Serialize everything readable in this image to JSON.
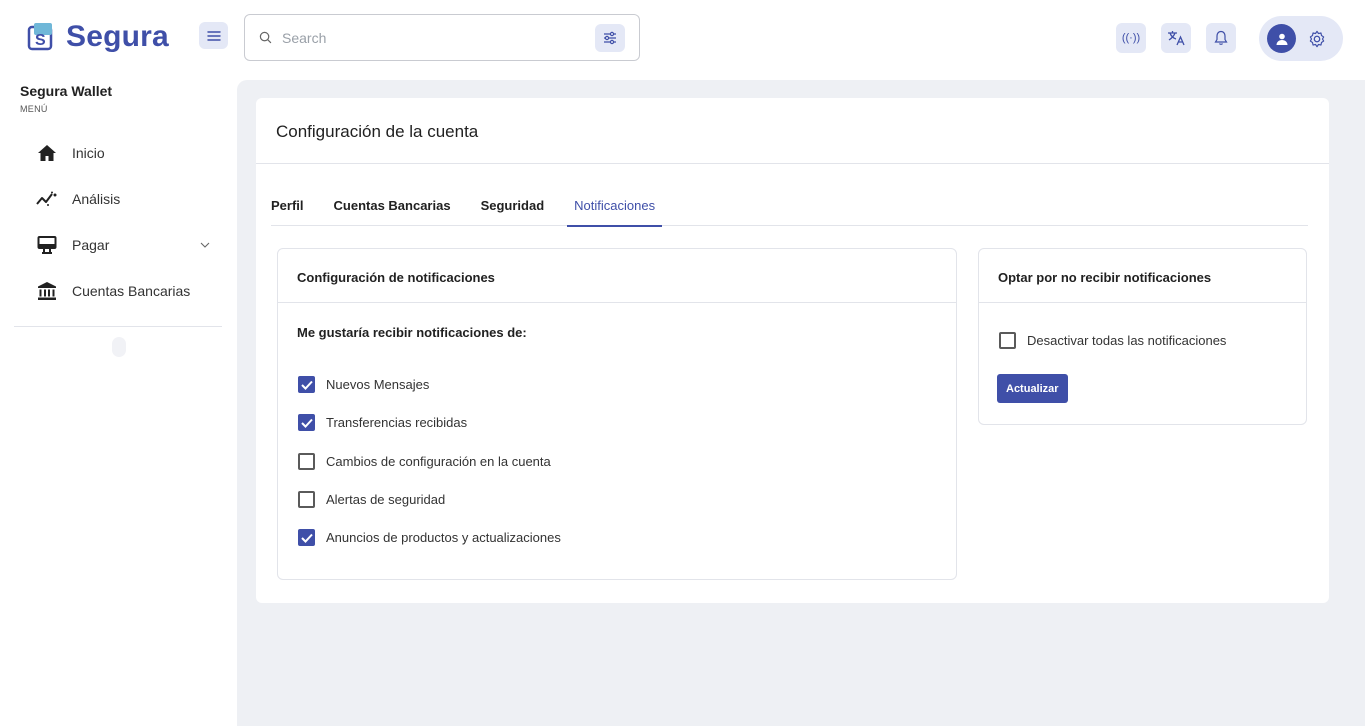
{
  "brand": {
    "name": "Segura",
    "accent": "#3f4fa8"
  },
  "search": {
    "placeholder": "Search"
  },
  "header": {
    "broadcast_icon_text": "((·))"
  },
  "sidebar": {
    "wallet_name": "Segura Wallet",
    "menu_label": "MENÚ",
    "items": [
      {
        "label": "Inicio",
        "icon": "home-icon"
      },
      {
        "label": "Análisis",
        "icon": "analytics-icon"
      },
      {
        "label": "Pagar",
        "icon": "payment-icon",
        "expandable": true
      },
      {
        "label": "Cuentas Bancarias",
        "icon": "bank-icon"
      }
    ]
  },
  "page": {
    "title": "Configuración de la cuenta",
    "tabs": [
      {
        "label": "Perfil",
        "active": false
      },
      {
        "label": "Cuentas Bancarias",
        "active": false
      },
      {
        "label": "Seguridad",
        "active": false
      },
      {
        "label": "Notificaciones",
        "active": true
      }
    ]
  },
  "notifications": {
    "title": "Configuración de notificaciones",
    "subtitle": "Me gustaría recibir notificaciones de:",
    "options": [
      {
        "label": "Nuevos Mensajes",
        "checked": true
      },
      {
        "label": "Transferencias recibidas",
        "checked": true
      },
      {
        "label": "Cambios de configuración en la cuenta",
        "checked": false
      },
      {
        "label": "Alertas de seguridad",
        "checked": false
      },
      {
        "label": "Anuncios de productos y actualizaciones",
        "checked": true
      }
    ]
  },
  "optout": {
    "title": "Optar por no recibir notificaciones",
    "checkbox_label": "Desactivar todas las notificaciones",
    "checked": false,
    "button_label": "Actualizar"
  }
}
